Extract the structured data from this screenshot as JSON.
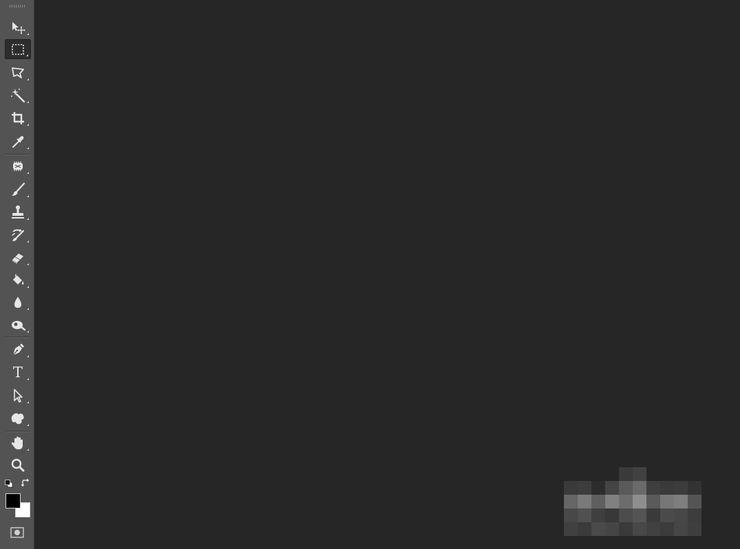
{
  "app": {
    "colors": {
      "canvas": "#262626",
      "toolbar": "#535353",
      "icon": "#e6e6e6",
      "active_tool_bg": "#2d2d2d",
      "foreground_color": "#000000",
      "background_color": "#ffffff"
    }
  },
  "toolbar": {
    "tools": [
      {
        "name": "move-tool",
        "icon": "move-icon",
        "active": false
      },
      {
        "name": "rectangular-marquee-tool",
        "icon": "marquee-icon",
        "active": true
      },
      {
        "name": "lasso-tool",
        "icon": "polygonal-lasso-icon",
        "active": false
      },
      {
        "name": "magic-wand-tool",
        "icon": "magic-wand-icon",
        "active": false
      },
      {
        "name": "crop-tool",
        "icon": "crop-icon",
        "active": false
      },
      {
        "name": "eyedropper-tool",
        "icon": "eyedropper-icon",
        "active": false
      },
      {
        "name": "healing-brush-tool",
        "icon": "healing-brush-icon",
        "active": false
      },
      {
        "name": "brush-tool",
        "icon": "brush-icon",
        "active": false
      },
      {
        "name": "clone-stamp-tool",
        "icon": "clone-stamp-icon",
        "active": false
      },
      {
        "name": "history-brush-tool",
        "icon": "history-brush-icon",
        "active": false
      },
      {
        "name": "eraser-tool",
        "icon": "eraser-icon",
        "active": false
      },
      {
        "name": "paint-bucket-tool",
        "icon": "paint-bucket-icon",
        "active": false
      },
      {
        "name": "blur-tool",
        "icon": "blur-drop-icon",
        "active": false
      },
      {
        "name": "dodge-tool",
        "icon": "dodge-icon",
        "active": false
      },
      {
        "name": "pen-tool",
        "icon": "pen-icon",
        "active": false
      },
      {
        "name": "type-tool",
        "icon": "type-icon",
        "active": false,
        "glyph": "T"
      },
      {
        "name": "path-selection-tool",
        "icon": "path-selection-icon",
        "active": false
      },
      {
        "name": "custom-shape-tool",
        "icon": "custom-shape-icon",
        "active": false
      },
      {
        "name": "hand-tool",
        "icon": "hand-icon",
        "active": false
      },
      {
        "name": "zoom-tool",
        "icon": "zoom-icon",
        "active": false
      }
    ]
  }
}
